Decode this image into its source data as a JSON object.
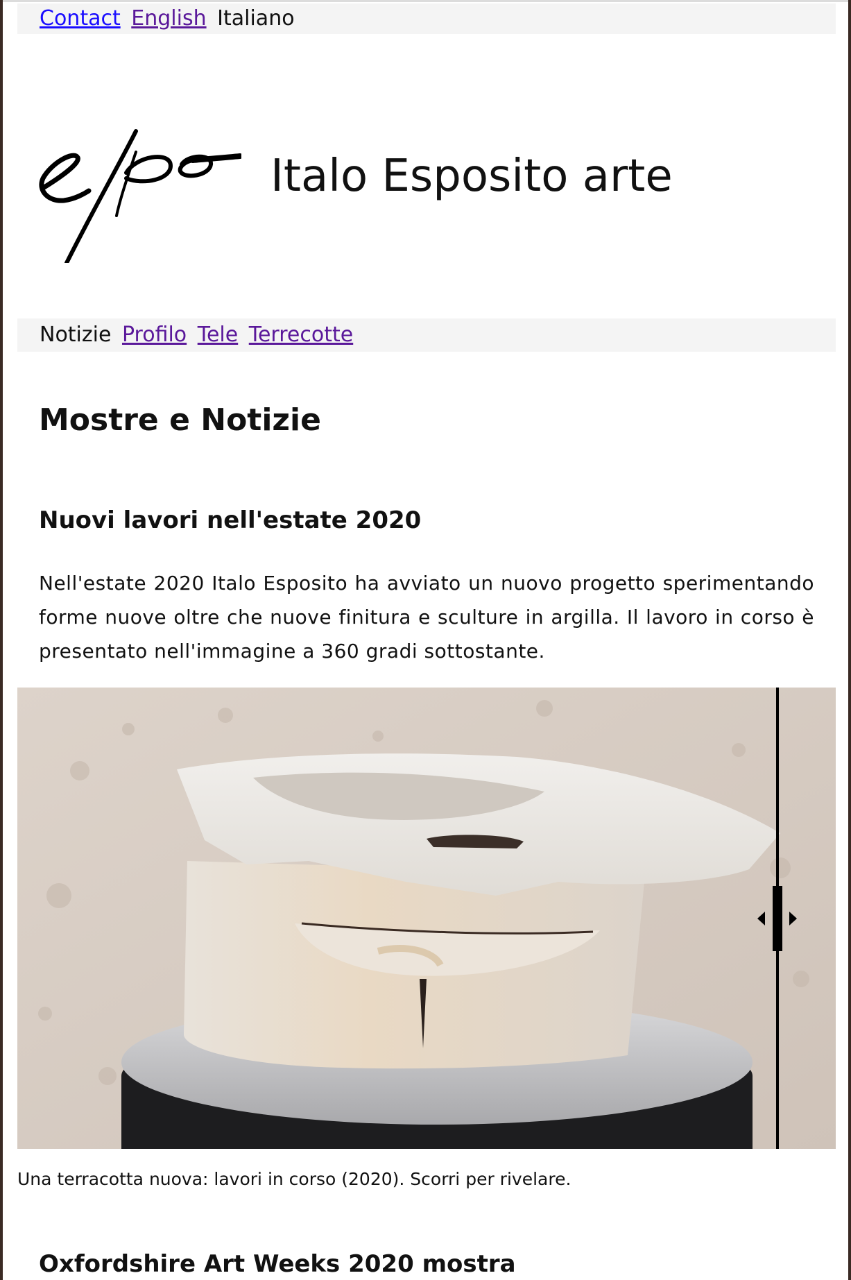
{
  "topbar": {
    "contact": "Contact",
    "english": "English",
    "italiano": "Italiano"
  },
  "header": {
    "site_title": "Italo Esposito arte",
    "logo_text": "espo"
  },
  "nav": {
    "items": [
      {
        "label": "Notizie",
        "active": true
      },
      {
        "label": "Profilo",
        "active": false
      },
      {
        "label": "Tele",
        "active": false
      },
      {
        "label": "Terrecotte",
        "active": false
      }
    ]
  },
  "main": {
    "page_title": "Mostre e Notizie",
    "section1": {
      "heading": "Nuovi lavori nell'estate 2020",
      "paragraph": "Nell'estate 2020 Italo Esposito ha avviato un nuovo progetto sperimentando forme nuove oltre che nuove finitura e sculture in argilla. Il lavoro in corso è presentato nell'immagine a 360 gradi sottostante.",
      "caption": "Una terracotta nuova: lavori in corso (2020). Scorri per rivelare."
    },
    "section2": {
      "heading": "Oxfordshire Art Weeks 2020 mostra"
    }
  },
  "colors": {
    "link_unvisited": "#1a0dff",
    "link_visited": "#5a189a",
    "bar_background": "#f4f4f4"
  }
}
